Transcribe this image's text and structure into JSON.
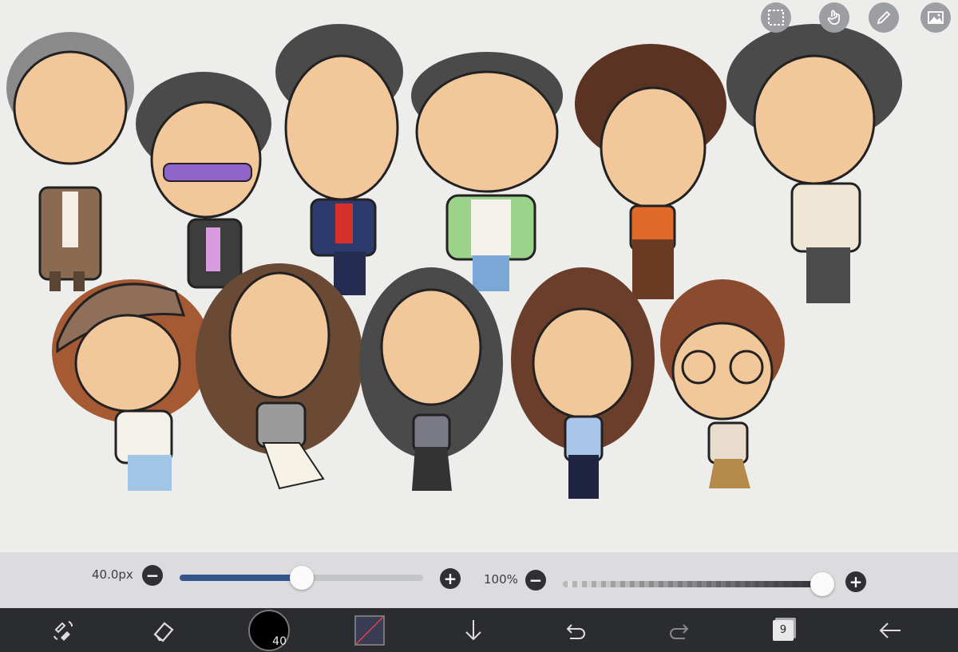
{
  "canvas": {
    "background": "#ededec",
    "artwork_description_icon": "chibi-characters-drawing"
  },
  "top_tools": [
    {
      "name": "selection-icon"
    },
    {
      "name": "hand-touch-icon"
    },
    {
      "name": "pencil-ruler-icon"
    },
    {
      "name": "image-icon"
    }
  ],
  "brush_size": {
    "label": "40.0px",
    "fraction": 0.5,
    "accent": "#33568a"
  },
  "opacity": {
    "label": "100%",
    "fraction": 1.0
  },
  "toolbar": {
    "brush_size_value": "40",
    "layer_count": "9",
    "color": "#3a3b55"
  }
}
